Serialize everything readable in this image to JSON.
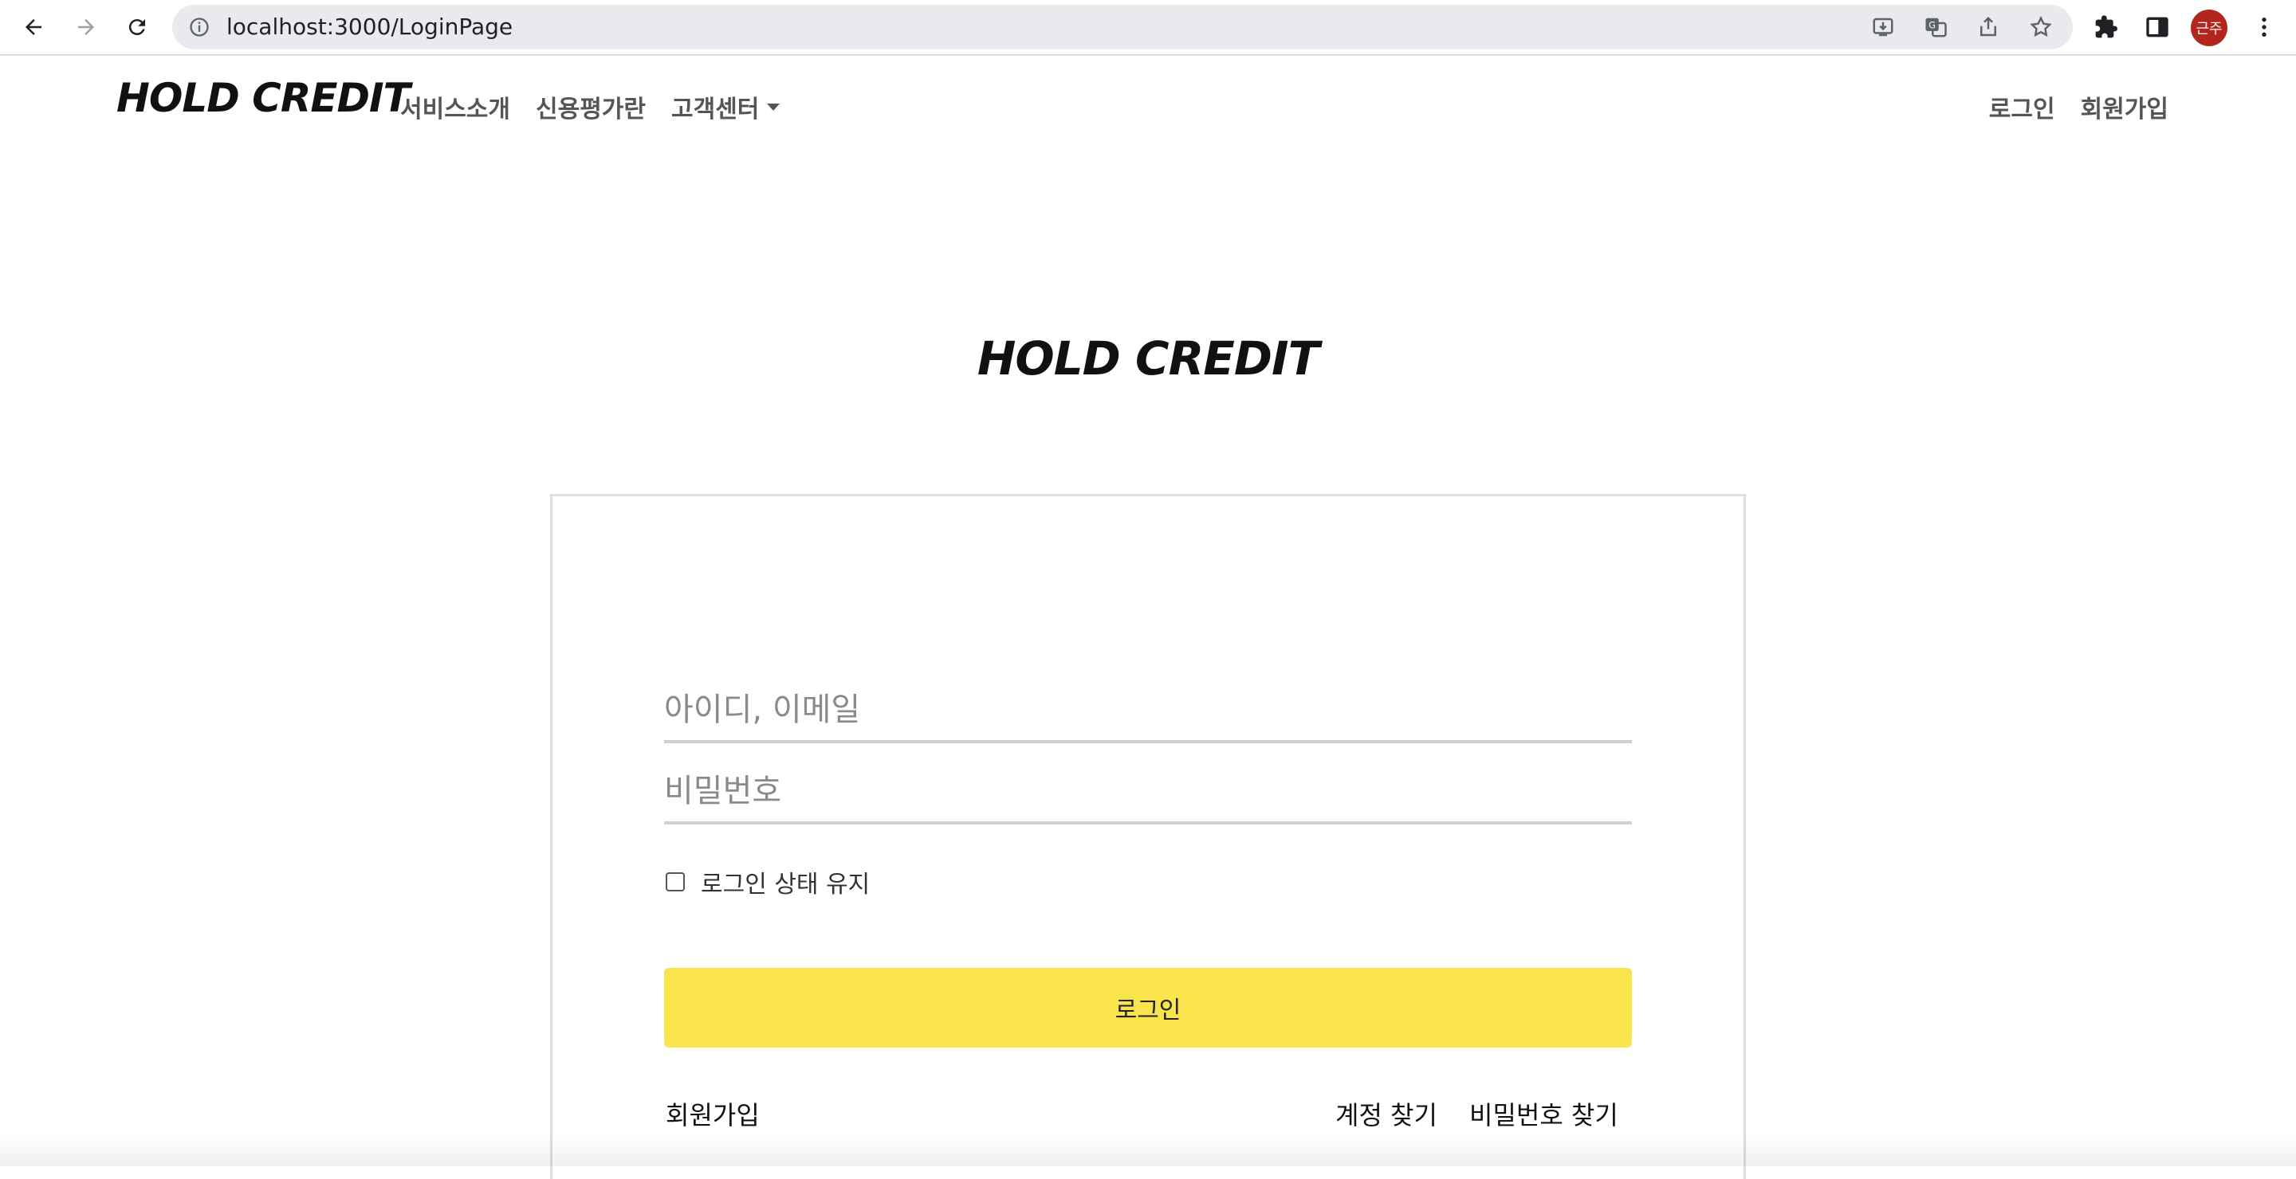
{
  "browser": {
    "url": "localhost:3000/LoginPage",
    "avatar_text": "근주"
  },
  "header": {
    "brand": "HOLD CREDIT",
    "menu": [
      "서비스소개",
      "신용평가란",
      "고객센터"
    ],
    "right_links": [
      "로그인",
      "회원가입"
    ]
  },
  "login": {
    "title": "HOLD CREDIT",
    "id_placeholder": "아이디, 이메일",
    "password_placeholder": "비밀번호",
    "keep_logged_in": "로그인 상태 유지",
    "login_button": "로그인",
    "signup_link": "회원가입",
    "find_account": "계정 찾기",
    "find_password": "비밀번호 찾기"
  },
  "colors": {
    "button_yellow": "#f9e54b",
    "avatar_red": "#b3261e"
  }
}
